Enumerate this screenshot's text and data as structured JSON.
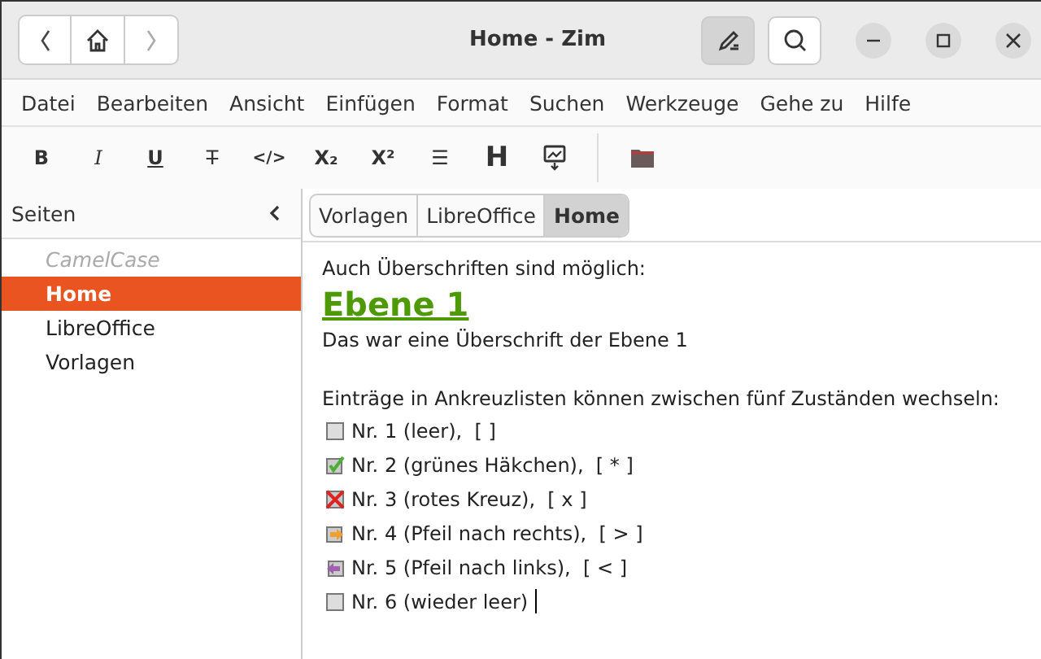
{
  "window": {
    "title": "Home - Zim"
  },
  "menu": [
    "Datei",
    "Bearbeiten",
    "Ansicht",
    "Einfügen",
    "Format",
    "Suchen",
    "Werkzeuge",
    "Gehe zu",
    "Hilfe"
  ],
  "toolbar": [
    {
      "kind": "bold",
      "glyph": "B"
    },
    {
      "kind": "italic",
      "glyph": "I"
    },
    {
      "kind": "underline",
      "glyph": "U"
    },
    {
      "kind": "strike",
      "glyph": "T"
    },
    {
      "kind": "code",
      "glyph": "</>"
    },
    {
      "kind": "sub",
      "glyph": "X₂"
    },
    {
      "kind": "sup",
      "glyph": "X²"
    },
    {
      "kind": "list",
      "glyph": "☰"
    },
    {
      "kind": "heading",
      "glyph": "H"
    },
    {
      "kind": "image"
    }
  ],
  "sidebar": {
    "title": "Seiten",
    "items": [
      {
        "label": "CamelCase",
        "selected": false,
        "placeholder": true
      },
      {
        "label": "Home",
        "selected": true,
        "placeholder": false
      },
      {
        "label": "LibreOffice",
        "selected": false,
        "placeholder": false
      },
      {
        "label": "Vorlagen",
        "selected": false,
        "placeholder": false
      }
    ]
  },
  "tabs": [
    {
      "label": "Vorlagen",
      "selected": false
    },
    {
      "label": "LibreOffice",
      "selected": false
    },
    {
      "label": "Home",
      "selected": true
    }
  ],
  "editor": {
    "intro": "Auch Überschriften sind möglich:",
    "heading": "Ebene 1",
    "after_heading": "Das war eine Überschrift der Ebene 1",
    "list_intro": "Einträge in Ankreuzlisten können zwischen fünf Zuständen wechseln:",
    "checkboxes": [
      {
        "kind": "empty",
        "label": "Nr. 1 (leer),  [ ]"
      },
      {
        "kind": "checked",
        "label": "Nr. 2 (grünes Häkchen),  [ * ]"
      },
      {
        "kind": "crossed",
        "label": "Nr. 3 (rotes Kreuz),  [ x ]"
      },
      {
        "kind": "right",
        "label": "Nr. 4 (Pfeil nach rechts),  [ > ]"
      },
      {
        "kind": "left",
        "label": "Nr. 5 (Pfeil nach links),  [ < ]"
      },
      {
        "kind": "empty",
        "label": "Nr. 6 (wieder leer)"
      }
    ]
  }
}
